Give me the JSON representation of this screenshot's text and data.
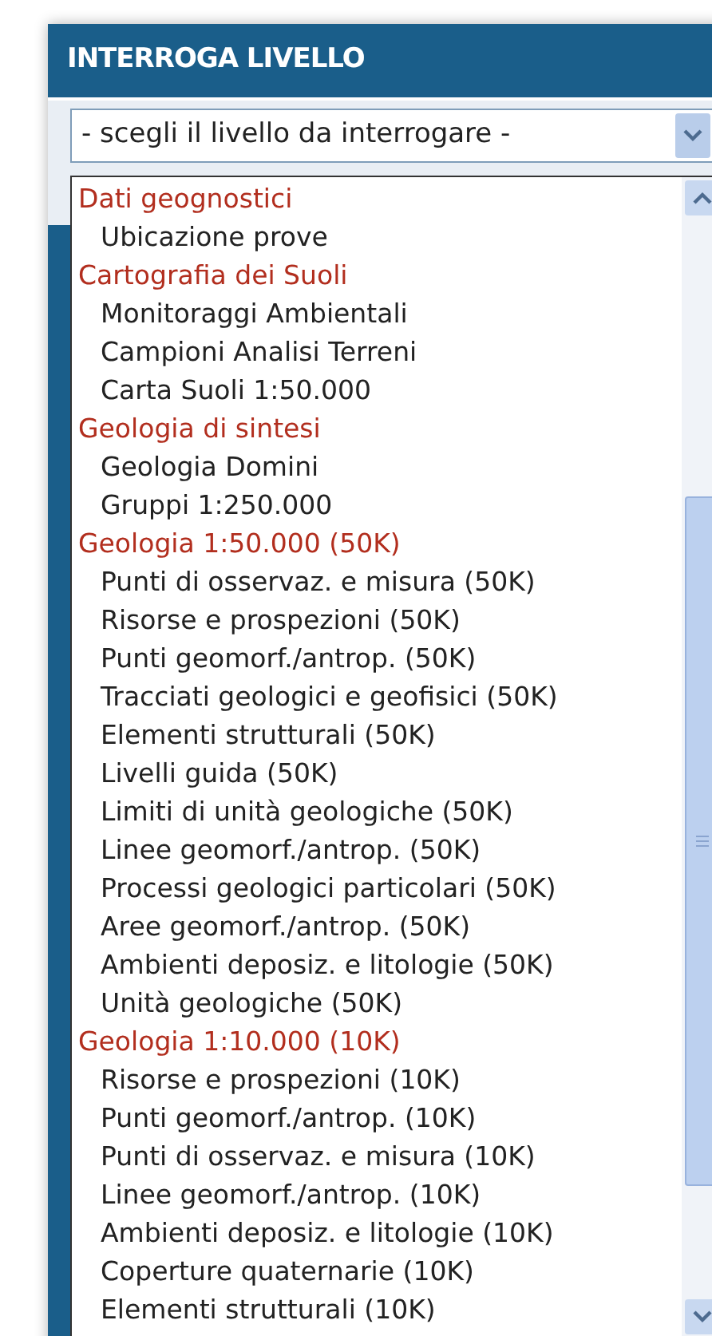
{
  "panel": {
    "title": "INTERROGA LIVELLO"
  },
  "select": {
    "value": "- scegli il livello da interrogare -",
    "expanded": true
  },
  "options": [
    {
      "label": "Dati geognostici",
      "children": [
        {
          "label": "Ubicazione prove"
        }
      ]
    },
    {
      "label": "Cartografia dei Suoli",
      "children": [
        {
          "label": "Monitoraggi Ambientali"
        },
        {
          "label": "Campioni Analisi Terreni"
        },
        {
          "label": "Carta Suoli 1:50.000"
        }
      ]
    },
    {
      "label": "Geologia di sintesi",
      "children": [
        {
          "label": "Geologia Domini"
        },
        {
          "label": "Gruppi 1:250.000"
        }
      ]
    },
    {
      "label": "Geologia 1:50.000 (50K)",
      "children": [
        {
          "label": "Punti di osservaz. e misura (50K)"
        },
        {
          "label": "Risorse e prospezioni (50K)"
        },
        {
          "label": "Punti geomorf./antrop. (50K)"
        },
        {
          "label": "Tracciati geologici e geofisici (50K)"
        },
        {
          "label": "Elementi strutturali (50K)"
        },
        {
          "label": "Livelli guida (50K)"
        },
        {
          "label": "Limiti di unità geologiche (50K)"
        },
        {
          "label": "Linee geomorf./antrop. (50K)"
        },
        {
          "label": "Processi geologici particolari (50K)"
        },
        {
          "label": "Aree geomorf./antrop. (50K)"
        },
        {
          "label": "Ambienti deposiz. e litologie (50K)"
        },
        {
          "label": "Unità geologiche (50K)"
        }
      ]
    },
    {
      "label": "Geologia 1:10.000 (10K)",
      "children": [
        {
          "label": "Risorse e prospezioni (10K)"
        },
        {
          "label": "Punti geomorf./antrop. (10K)"
        },
        {
          "label": "Punti di osservaz. e misura (10K)"
        },
        {
          "label": "Linee geomorf./antrop. (10K)"
        },
        {
          "label": "Ambienti deposiz. e litologie (10K)"
        },
        {
          "label": "Coperture quaternarie (10K)"
        },
        {
          "label": "Elementi strutturali (10K)"
        }
      ]
    }
  ]
}
